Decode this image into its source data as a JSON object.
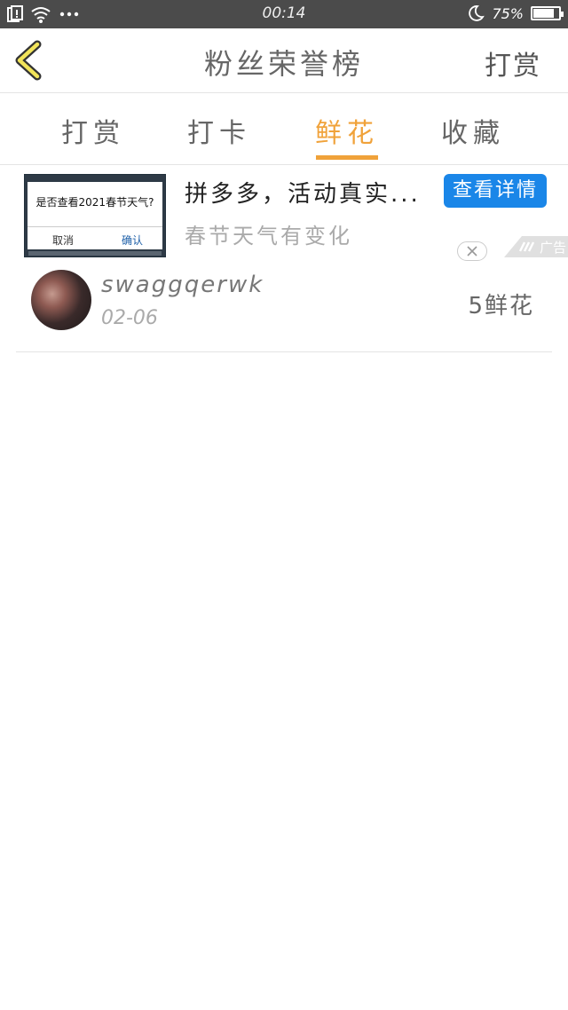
{
  "status_bar": {
    "time": "00:14",
    "battery_percent": "75%",
    "battery_level": 0.75,
    "icons": [
      "notification-icon",
      "wifi-icon",
      "more-dots-icon",
      "moon-icon",
      "battery-icon"
    ]
  },
  "header": {
    "title": "粉丝荣誉榜",
    "action_label": "打赏"
  },
  "tabs": [
    {
      "label": "打赏"
    },
    {
      "label": "打卡"
    },
    {
      "label": "鲜花"
    },
    {
      "label": "收藏"
    }
  ],
  "active_tab": "鲜花",
  "ad": {
    "thumb_question": "是否查看2021春节天气?",
    "thumb_cancel": "取消",
    "thumb_confirm": "确认",
    "title": "拼多多，活动真实...",
    "subtitle": "春节天气有变化",
    "button_label": "查看详情",
    "tag": "广告",
    "button_color": "#1a86e8"
  },
  "list": [
    {
      "name": "swaggqerwk",
      "date": "02-06",
      "amount": "5鲜花"
    }
  ],
  "colors": {
    "accent": "#f0a23a",
    "status_bar": "#4b4b4b"
  }
}
